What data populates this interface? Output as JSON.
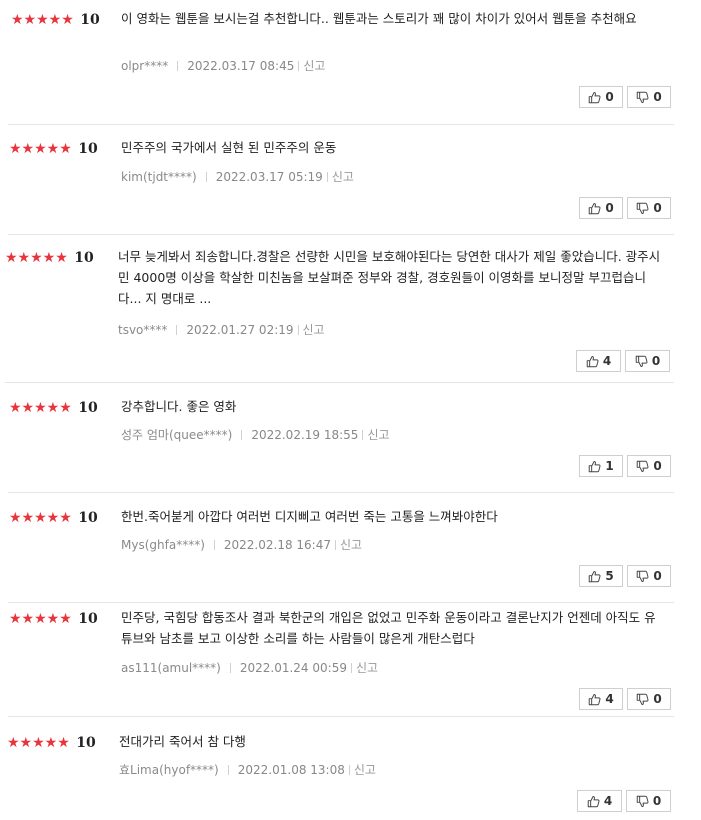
{
  "ui": {
    "accent_color": "#e8343c"
  },
  "reviews": [
    {
      "stars": "★★★★★",
      "score": "10",
      "text": "이 영화는 웹툰을 보시는걸 추천합니다.. 웹툰과는 스토리가 꽤 많이 차이가 있어서 웹툰을 추천해요",
      "user": "olpr****",
      "date": "2022.03.17 08:45",
      "report": "신고",
      "likes": "0",
      "dislikes": "0"
    },
    {
      "stars": "★★★★★",
      "score": "10",
      "text": "민주주의 국가에서 실현 된 민주주의 운동",
      "user": "kim(tjdt****)",
      "date": "2022.03.17 05:19",
      "report": "신고",
      "likes": "0",
      "dislikes": "0"
    },
    {
      "stars": "★★★★★",
      "score": "10",
      "text": "너무 늦게봐서 죄송합니다.경찰은 선량한 시민을 보호해야된다는 당연한 대사가 제일 좋았습니다. 광주시민 4000명 이상을 학살한 미친놈을 보살펴준 정부와 경찰, 경호원들이 이영화를 보니정말 부끄럽습니다... 지 명대로 ...",
      "user": "tsvo****",
      "date": "2022.01.27 02:19",
      "report": "신고",
      "likes": "4",
      "dislikes": "0"
    },
    {
      "stars": "★★★★★",
      "score": "10",
      "text": "강추합니다. 좋은 영화",
      "user": "성주 엄마(quee****)",
      "date": "2022.02.19 18:55",
      "report": "신고",
      "likes": "1",
      "dislikes": "0"
    },
    {
      "stars": "★★★★★",
      "score": "10",
      "text": "한번.죽어붇게 아깝다 여러번 디지삐고 여러번 죽는 고통을 느껴봐야한다",
      "user": "Mys(ghfa****)",
      "date": "2022.02.18 16:47",
      "report": "신고",
      "likes": "5",
      "dislikes": "0"
    },
    {
      "stars": "★★★★★",
      "score": "10",
      "text": "민주당, 국힘당 합동조사 결과 북한군의 개입은 없었고 민주화 운동이라고 결론난지가 언젠데 아직도 유튜브와 남초를 보고 이상한 소리를 하는 사람들이 많은게 개탄스럽다",
      "user": "as111(amul****)",
      "date": "2022.01.24 00:59",
      "report": "신고",
      "likes": "4",
      "dislikes": "0"
    },
    {
      "stars": "★★★★★",
      "score": "10",
      "text": "전대가리 죽어서 참 다행",
      "user": "효Lima(hyof****)",
      "date": "2022.01.08 13:08",
      "report": "신고",
      "likes": "4",
      "dislikes": "0"
    }
  ]
}
